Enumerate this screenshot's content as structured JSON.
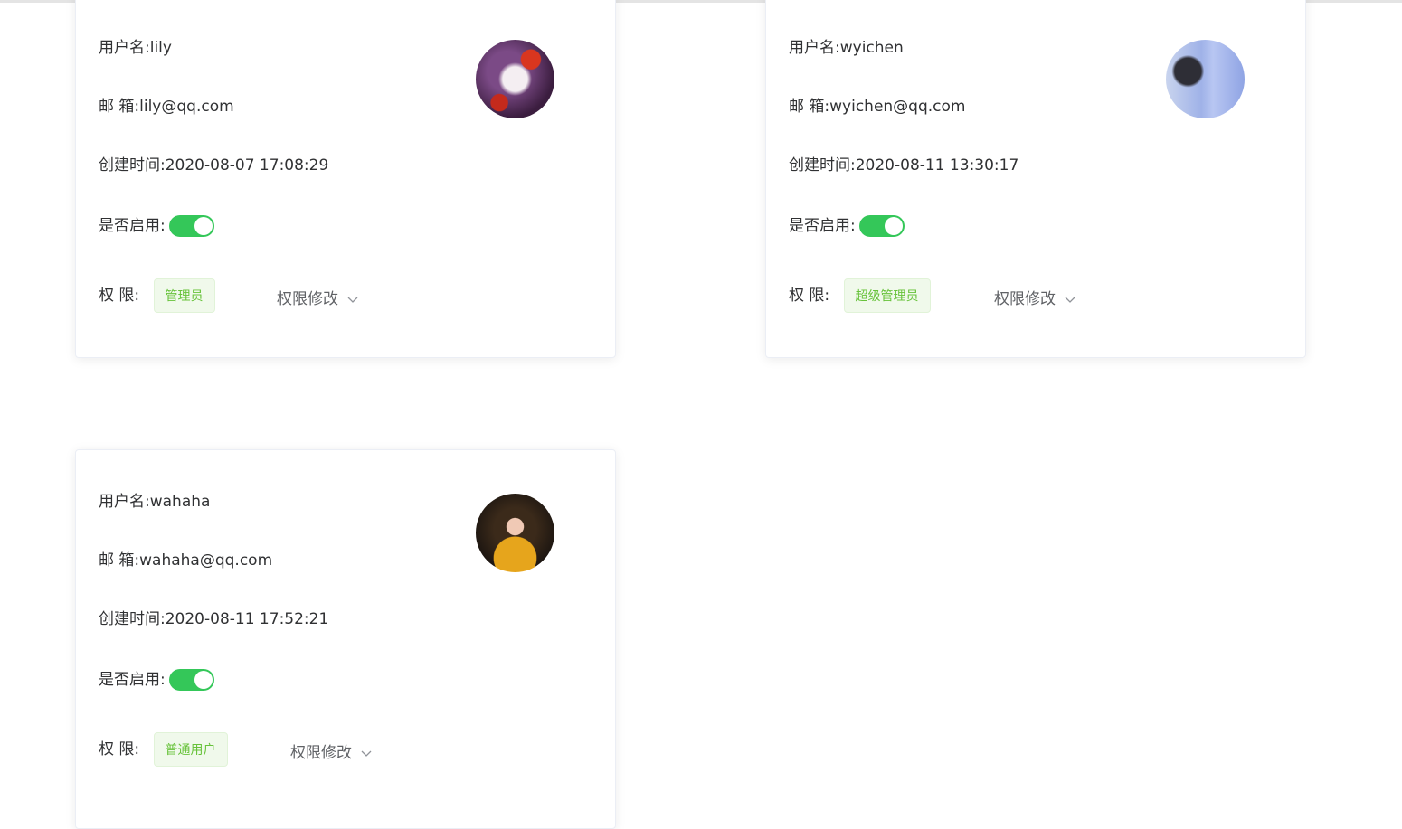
{
  "labels": {
    "username": "用户名:",
    "email": "邮 箱:",
    "created": "创建时间:",
    "enabled": "是否启用:",
    "role": "权 限:",
    "modify": "权限修改"
  },
  "users": [
    {
      "username": "lily",
      "email": "lily@qq.com",
      "created": "2020-08-07 17:08:29",
      "enabled": true,
      "role": "管理员"
    },
    {
      "username": "wyichen",
      "email": "wyichen@qq.com",
      "created": "2020-08-11 13:30:17",
      "enabled": true,
      "role": "超级管理员"
    },
    {
      "username": "wahaha",
      "email": "wahaha@qq.com",
      "created": "2020-08-11 17:52:21",
      "enabled": true,
      "role": "普通用户"
    }
  ],
  "colors": {
    "toggle_on": "#34c759",
    "tag_text": "#67c23a",
    "tag_bg": "#f0f9eb"
  },
  "icons": {
    "dropdown": "chevron-down-icon"
  }
}
